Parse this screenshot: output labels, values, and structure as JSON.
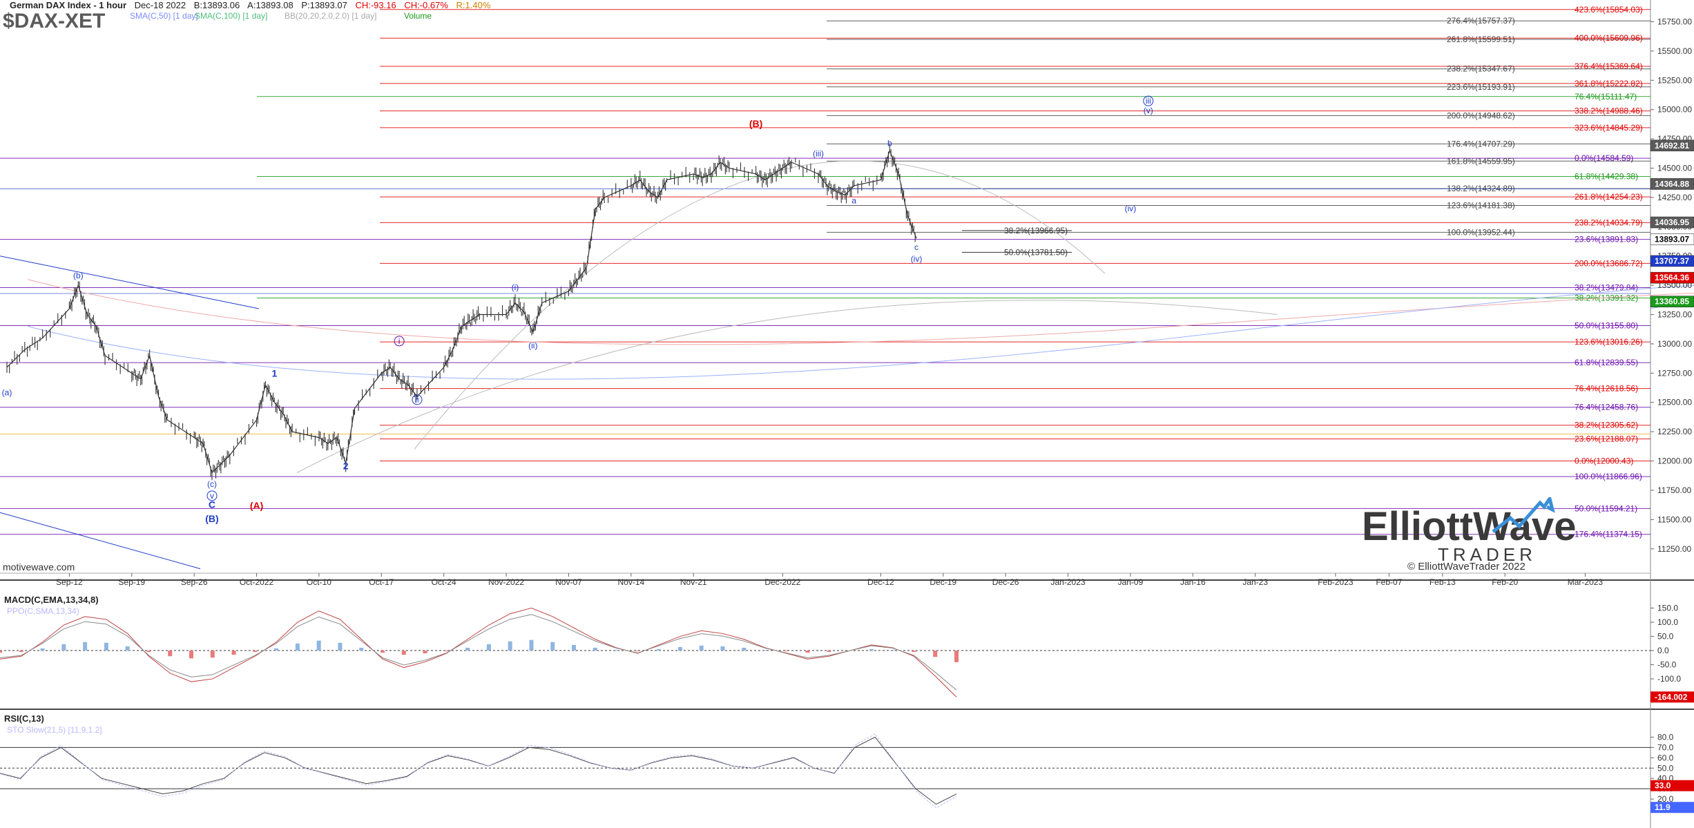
{
  "header": {
    "title": "German DAX Index - 1 hour",
    "date": "Dec-18 2022",
    "bid": "B:13893.06",
    "ask": "A:13893.08",
    "price": "P:13893.07",
    "change": "CH:-93.16",
    "change_pct": "CH:-0.67%",
    "range": "R:1.40%",
    "ticker": "$DAX-XET",
    "indicators": [
      "SMA(C,50) [1 day]",
      "SMA(C,100) [1 day]",
      "BB(20,20,2.0,2.0) [1 day]",
      "Volume"
    ]
  },
  "footer": {
    "source": "motivewave.com",
    "copyright": "© ElliottWaveTrader 2022",
    "logo_main": "ElliottWave",
    "logo_sub": "TRADER"
  },
  "colors": {
    "price": "#333333",
    "red": "#e00000",
    "green": "#1a9a1a",
    "blue": "#1e3cc8",
    "purple": "#6a0dad",
    "gray": "#444444",
    "orange": "#e8a000",
    "macd_pos": "#8fb6e0",
    "macd_neg": "#e87c7c"
  },
  "chart_data": [
    {
      "type": "candlestick",
      "title": "German DAX Index - 1 hour",
      "x_ticks": [
        "Sep-12",
        "Sep-19",
        "Sep-26",
        "Oct-2022",
        "Oct-10",
        "Oct-17",
        "Oct-24",
        "Nov-2022",
        "Nov-07",
        "Nov-14",
        "Nov-21",
        "Dec-2022",
        "Dec-12",
        "Dec-19",
        "Dec-26",
        "Jan-2023",
        "Jan-09",
        "Jan-16",
        "Jan-23",
        "Feb-2023",
        "Feb-07",
        "Feb-13",
        "Feb-20",
        "Mar-2023"
      ],
      "y_ticks": [
        11250,
        11500,
        11750,
        12000,
        12250,
        12500,
        12750,
        13000,
        13250,
        13500,
        13750,
        14000,
        14250,
        14500,
        14750,
        15000,
        15250,
        15500,
        15750
      ],
      "ylim": [
        11060,
        15900
      ],
      "series_close": [
        [
          "Sep-05",
          12800
        ],
        [
          "Sep-07",
          12950
        ],
        [
          "Sep-09",
          13050
        ],
        [
          "Sep-12",
          13300
        ],
        [
          "Sep-13",
          13500
        ],
        [
          "Sep-14",
          13250
        ],
        [
          "Sep-15",
          13150
        ],
        [
          "Sep-16",
          12900
        ],
        [
          "Sep-19",
          12750
        ],
        [
          "Sep-20",
          12700
        ],
        [
          "Sep-21",
          12900
        ],
        [
          "Sep-22",
          12550
        ],
        [
          "Sep-23",
          12350
        ],
        [
          "Sep-26",
          12200
        ],
        [
          "Sep-27",
          12150
        ],
        [
          "Sep-28",
          11900
        ],
        [
          "Sep-29",
          11975
        ],
        [
          "Sep-30",
          12050
        ],
        [
          "Oct-03",
          12350
        ],
        [
          "Oct-04",
          12650
        ],
        [
          "Oct-05",
          12500
        ],
        [
          "Oct-06",
          12400
        ],
        [
          "Oct-07",
          12250
        ],
        [
          "Oct-10",
          12200
        ],
        [
          "Oct-11",
          12150
        ],
        [
          "Oct-12",
          12200
        ],
        [
          "Oct-13",
          11980
        ],
        [
          "Oct-14",
          12450
        ],
        [
          "Oct-17",
          12750
        ],
        [
          "Oct-18",
          12800
        ],
        [
          "Oct-19",
          12700
        ],
        [
          "Oct-20",
          12650
        ],
        [
          "Oct-21",
          12550
        ],
        [
          "Oct-24",
          12800
        ],
        [
          "Oct-25",
          12950
        ],
        [
          "Oct-26",
          13150
        ],
        [
          "Oct-27",
          13200
        ],
        [
          "Oct-28",
          13250
        ],
        [
          "Oct-31",
          13250
        ],
        [
          "Nov-01",
          13350
        ],
        [
          "Nov-02",
          13270
        ],
        [
          "Nov-03",
          13100
        ],
        [
          "Nov-04",
          13350
        ],
        [
          "Nov-07",
          13450
        ],
        [
          "Nov-08",
          13550
        ],
        [
          "Nov-09",
          13650
        ],
        [
          "Nov-10",
          14150
        ],
        [
          "Nov-11",
          14250
        ],
        [
          "Nov-14",
          14350
        ],
        [
          "Nov-15",
          14400
        ],
        [
          "Nov-16",
          14300
        ],
        [
          "Nov-17",
          14250
        ],
        [
          "Nov-18",
          14400
        ],
        [
          "Nov-21",
          14450
        ],
        [
          "Nov-22",
          14420
        ],
        [
          "Nov-23",
          14450
        ],
        [
          "Nov-24",
          14550
        ],
        [
          "Nov-25",
          14500
        ],
        [
          "Nov-28",
          14450
        ],
        [
          "Nov-29",
          14400
        ],
        [
          "Nov-30",
          14450
        ],
        [
          "Dec-01",
          14500
        ],
        [
          "Dec-02",
          14550
        ],
        [
          "Dec-05",
          14450
        ],
        [
          "Dec-06",
          14350
        ],
        [
          "Dec-07",
          14300
        ],
        [
          "Dec-08",
          14270
        ],
        [
          "Dec-09",
          14350
        ],
        [
          "Dec-12",
          14400
        ],
        [
          "Dec-13",
          14650
        ],
        [
          "Dec-14",
          14450
        ],
        [
          "Dec-15",
          14100
        ],
        [
          "Dec-16",
          13900
        ]
      ],
      "fib_levels": [
        {
          "label": "423.6%(15854.03)",
          "value": 15854.03,
          "color": "red"
        },
        {
          "label": "276.4%(15757.37)",
          "value": 15757.37,
          "color": "gray"
        },
        {
          "label": "261.8%(15599.51)",
          "value": 15599.51,
          "color": "gray"
        },
        {
          "label": "400.0%(15609.96)",
          "value": 15609.96,
          "color": "red"
        },
        {
          "label": "376.4%(15369.64)",
          "value": 15369.64,
          "color": "red"
        },
        {
          "label": "238.2%(15347.67)",
          "value": 15347.67,
          "color": "gray"
        },
        {
          "label": "361.8%(15222.82)",
          "value": 15222.82,
          "color": "red"
        },
        {
          "label": "223.6%(15193.91)",
          "value": 15193.91,
          "color": "gray"
        },
        {
          "label": "76.4%(15111.47)",
          "value": 15111.47,
          "color": "green"
        },
        {
          "label": "338.2%(14988.46)",
          "value": 14988.46,
          "color": "red"
        },
        {
          "label": "200.0%(14948.62)",
          "value": 14948.62,
          "color": "gray"
        },
        {
          "label": "323.6%(14845.29)",
          "value": 14845.29,
          "color": "red"
        },
        {
          "label": "176.4%(14707.29)",
          "value": 14707.29,
          "color": "gray"
        },
        {
          "label": "0.0%(14584.59)",
          "value": 14584.59,
          "color": "purple"
        },
        {
          "label": "161.8%(14559.95)",
          "value": 14559.95,
          "color": "gray"
        },
        {
          "label": "61.8%(14429.38)",
          "value": 14429.38,
          "color": "green"
        },
        {
          "label": "138.2%(14324.89)",
          "value": 14324.89,
          "color": "gray"
        },
        {
          "label": "261.8%(14254.23)",
          "value": 14254.23,
          "color": "red"
        },
        {
          "label": "123.6%(14181.38)",
          "value": 14181.38,
          "color": "gray"
        },
        {
          "label": "238.2%(14034.79)",
          "value": 14034.79,
          "color": "red"
        },
        {
          "label": "100.0%(13952.44)",
          "value": 13952.44,
          "color": "gray"
        },
        {
          "label": "23.6%(13891.83)",
          "value": 13891.83,
          "color": "purple"
        },
        {
          "label": "200.0%(13686.72)",
          "value": 13686.72,
          "color": "red"
        },
        {
          "label": "38.2%(13479.84)",
          "value": 13479.84,
          "color": "purple"
        },
        {
          "label": "38.2%(13391.32)",
          "value": 13391.32,
          "color": "green"
        },
        {
          "label": "50.0%(13155.80)",
          "value": 13155.8,
          "color": "purple"
        },
        {
          "label": "123.6%(13016.26)",
          "value": 13016.26,
          "color": "red"
        },
        {
          "label": "61.8%(12839.55)",
          "value": 12839.55,
          "color": "purple"
        },
        {
          "label": "76.4%(12618.56)",
          "value": 12618.56,
          "color": "red"
        },
        {
          "label": "76.4%(12458.76)",
          "value": 12458.76,
          "color": "purple"
        },
        {
          "label": "38.2%(12305.62)",
          "value": 12305.62,
          "color": "red"
        },
        {
          "label": "23.6%(12188.07)",
          "value": 12188.07,
          "color": "red"
        },
        {
          "label": "0.0%(12000.43)",
          "value": 12000.43,
          "color": "red"
        },
        {
          "label": "100.0%(11866.96)",
          "value": 11866.96,
          "color": "purple"
        },
        {
          "label": "50.0%(11594.21)",
          "value": 11594.21,
          "color": "purple"
        },
        {
          "label": "176.4%(11374.15)",
          "value": 11374.15,
          "color": "purple"
        }
      ],
      "short_fibs": [
        {
          "label": "38.2%(13966.95)",
          "value": 13966.95
        },
        {
          "label": "50.0%(13781.50)",
          "value": 13781.5
        }
      ],
      "price_tags": [
        {
          "label": "14692.81",
          "value": 14692.81,
          "color": "gray"
        },
        {
          "label": "14364.88",
          "value": 14364.88,
          "color": "gray"
        },
        {
          "label": "14036.95",
          "value": 14036.95,
          "color": "gray"
        },
        {
          "label": "13893.07",
          "value": 13893.07,
          "color": "white"
        },
        {
          "label": "13707.37",
          "value": 13707.37,
          "color": "blue"
        },
        {
          "label": "13564.36",
          "value": 13564.36,
          "color": "red"
        },
        {
          "label": "13360.85",
          "value": 13360.85,
          "color": "green"
        }
      ],
      "wave_labels": [
        {
          "text": "(a)",
          "date": "Sep-05",
          "value": 12560,
          "color": "blue"
        },
        {
          "text": "(b)",
          "date": "Sep-13",
          "value": 13560,
          "color": "blue"
        },
        {
          "text": "(c)",
          "date": "Sep-28",
          "value": 11780,
          "color": "blue"
        },
        {
          "text": "v",
          "date": "Sep-28",
          "value": 11680,
          "color": "blue",
          "circled": true
        },
        {
          "text": "C",
          "date": "Sep-28",
          "value": 11600,
          "color": "blue",
          "bold": true
        },
        {
          "text": "(B)",
          "date": "Sep-28",
          "value": 11480,
          "color": "blue",
          "bold": true
        },
        {
          "text": "(A)",
          "date": "Oct-03",
          "value": 11590,
          "color": "red",
          "bold": true
        },
        {
          "text": "1",
          "date": "Oct-05",
          "value": 12720,
          "color": "blue",
          "bold": true
        },
        {
          "text": "2",
          "date": "Oct-13",
          "value": 11930,
          "color": "blue",
          "bold": true
        },
        {
          "text": "i",
          "date": "Oct-19",
          "value": 13000,
          "color": "purple",
          "circled": true
        },
        {
          "text": "ii",
          "date": "Oct-21",
          "value": 12500,
          "color": "blue",
          "circled": true
        },
        {
          "text": "(i)",
          "date": "Nov-01",
          "value": 13460,
          "color": "blue"
        },
        {
          "text": "(ii)",
          "date": "Nov-03",
          "value": 12960,
          "color": "blue"
        },
        {
          "text": "(B)",
          "date": "Nov-28",
          "value": 14850,
          "color": "red",
          "bold": true
        },
        {
          "text": "(iii)",
          "date": "Dec-05",
          "value": 14600,
          "color": "blue"
        },
        {
          "text": "a",
          "date": "Dec-09",
          "value": 14200,
          "color": "blue"
        },
        {
          "text": "b",
          "date": "Dec-13",
          "value": 14690,
          "color": "blue"
        },
        {
          "text": "c",
          "date": "Dec-16",
          "value": 13800,
          "color": "blue"
        },
        {
          "text": "(iv)",
          "date": "Dec-16",
          "value": 13700,
          "color": "blue"
        },
        {
          "text": "(iv)",
          "date": "Jan-09",
          "value": 14130,
          "color": "blue"
        },
        {
          "text": "iii",
          "date": "Jan-11",
          "value": 15050,
          "color": "blue",
          "circled": true
        },
        {
          "text": "(v)",
          "date": "Jan-11",
          "value": 14970,
          "color": "blue"
        }
      ]
    },
    {
      "type": "line",
      "title": "MACD(C,EMA,13,34,8)",
      "subtitle": "PPO(C,SMA,13,34)",
      "y_ticks": [
        150,
        100,
        50,
        0,
        -50,
        -100
      ],
      "ylim": [
        -190,
        200
      ],
      "last_value_tag": "-164.002",
      "series": [
        {
          "name": "MACD",
          "values": [
            -30,
            -20,
            30,
            90,
            120,
            110,
            60,
            -20,
            -80,
            -110,
            -100,
            -60,
            -20,
            30,
            100,
            140,
            110,
            40,
            -30,
            -60,
            -40,
            -10,
            40,
            90,
            130,
            150,
            120,
            80,
            40,
            10,
            -10,
            20,
            50,
            70,
            60,
            40,
            10,
            -10,
            -30,
            -20,
            0,
            20,
            10,
            -20,
            -90,
            -164
          ]
        }
      ]
    },
    {
      "type": "line",
      "title": "RSI(C,13)",
      "subtitle": "STO Slow(21,5) [11,9,1.2]",
      "y_ticks": [
        80,
        70,
        60,
        50,
        40,
        30,
        20,
        10
      ],
      "ylim": [
        -2,
        95
      ],
      "reference_lines": [
        70,
        50,
        30
      ],
      "tags": [
        "33.0",
        "11.9"
      ],
      "series": [
        {
          "name": "RSI",
          "values": [
            45,
            40,
            60,
            70,
            55,
            40,
            35,
            30,
            25,
            28,
            35,
            40,
            55,
            65,
            60,
            50,
            45,
            40,
            35,
            38,
            42,
            55,
            62,
            58,
            52,
            60,
            70,
            68,
            62,
            55,
            50,
            48,
            55,
            60,
            62,
            58,
            52,
            50,
            55,
            60,
            50,
            45,
            70,
            80,
            55,
            30,
            15,
            25
          ]
        }
      ]
    }
  ]
}
